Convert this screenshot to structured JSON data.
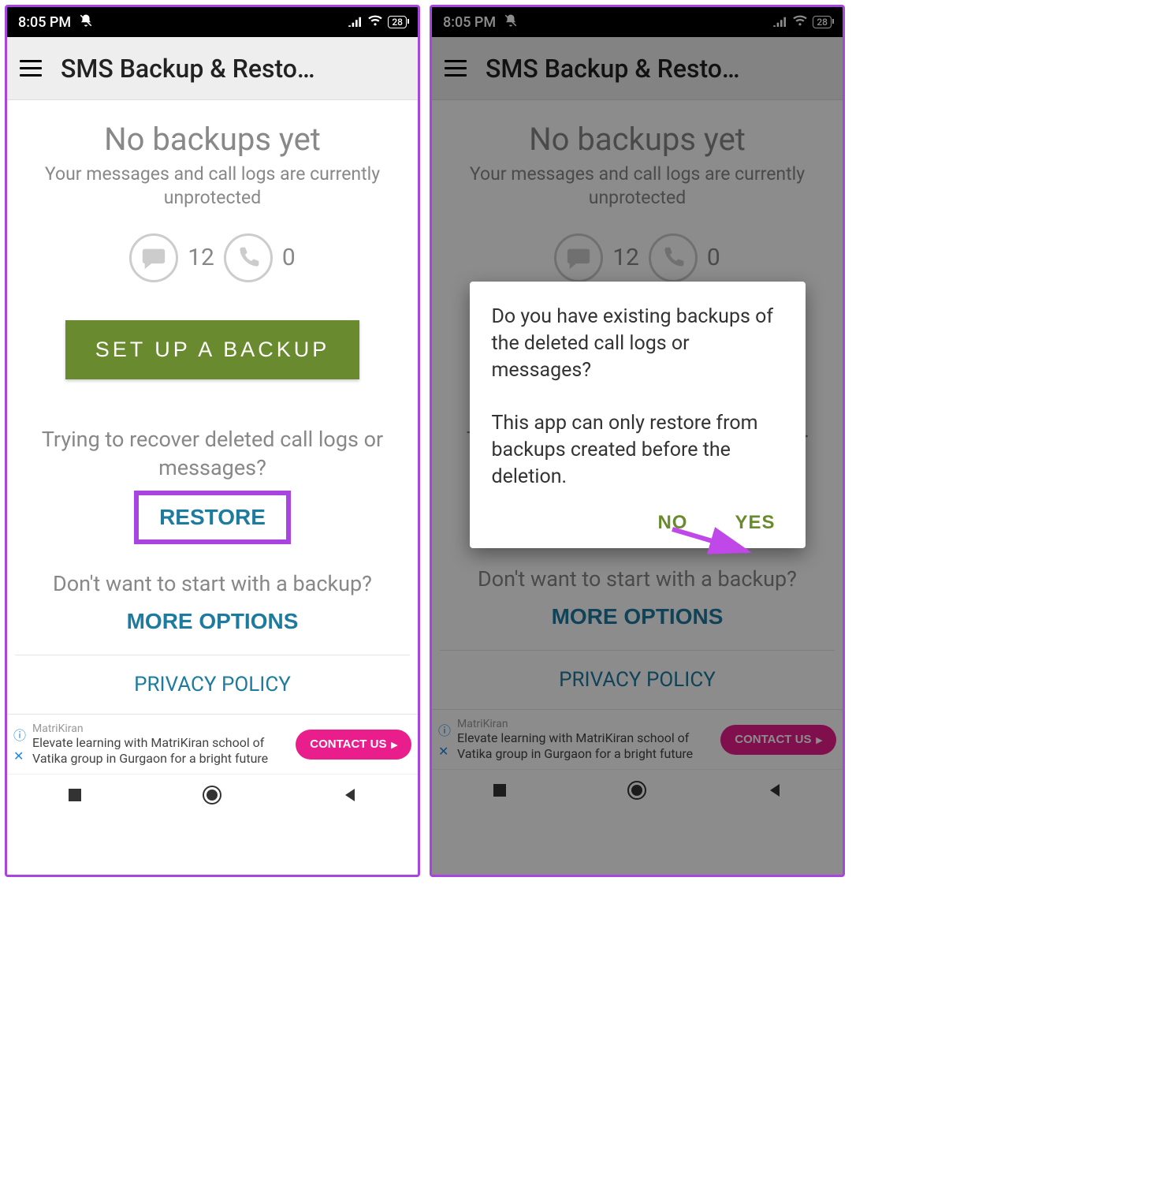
{
  "status": {
    "time": "8:05 PM",
    "battery": "28"
  },
  "app_bar": {
    "title": "SMS Backup & Resto…"
  },
  "main": {
    "no_backups": "No backups yet",
    "subtitle": "Your messages and call logs are currently unprotected",
    "msg_count": "12",
    "call_count": "0",
    "setup_label": "SET UP A BACKUP",
    "recover_text": "Trying to recover deleted call logs or messages?",
    "restore_label": "RESTORE",
    "dont_want": "Don't want to start with a backup?",
    "more_options": "MORE OPTIONS",
    "privacy": "PRIVACY POLICY"
  },
  "ad": {
    "brand": "MatriKiran",
    "desc": "Elevate learning with MatriKiran school of Vatika group in Gurgaon for a bright future",
    "cta": "CONTACT US"
  },
  "dialog": {
    "line1": "Do you have existing backups of the deleted call logs or messages?",
    "line2": "This app can only restore from backups created before the deletion.",
    "no": "NO",
    "yes": "YES"
  }
}
